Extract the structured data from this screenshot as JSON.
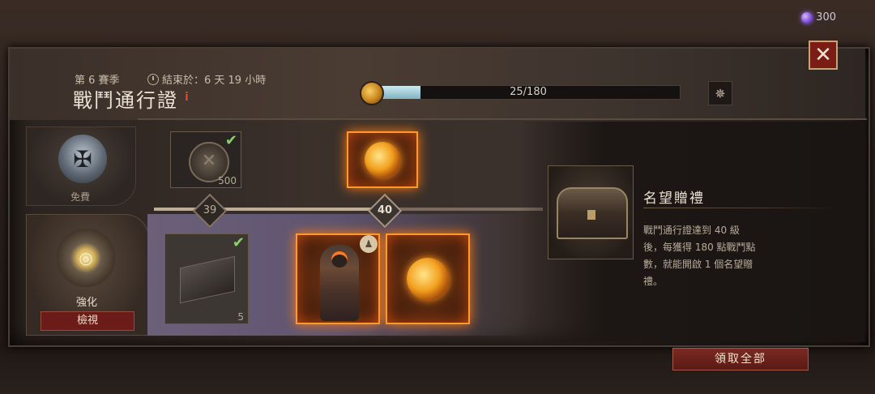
{
  "currency": {
    "amount": "300",
    "icon": "purple-orb-icon"
  },
  "header": {
    "season": "第 6 賽季",
    "timer_label": "結束於：6 天 19 小時",
    "title": "戰鬥通行證",
    "info_icon": "i"
  },
  "progress": {
    "text": "25/180",
    "current": 25,
    "max": 180
  },
  "tiers": {
    "free": {
      "label": "免費"
    },
    "upgraded": {
      "label": "強化",
      "inspect_button": "檢視"
    }
  },
  "levels": {
    "prev": "39",
    "current": "40"
  },
  "rewards": {
    "free_1": {
      "quantity": "500",
      "claimed": true
    },
    "upgraded_1": {
      "quantity": "5",
      "claimed": true
    }
  },
  "detail": {
    "title": "名望贈禮",
    "description": "戰鬥通行證達到 40 級後，每獲得 180 點戰鬥點數，就能開啟 1 個名望贈禮。"
  },
  "actions": {
    "claim_all": "領取全部"
  },
  "colors": {
    "accent": "#ff9a2a",
    "button": "#6b1c18",
    "progress_fill": "#9fcdd8"
  }
}
